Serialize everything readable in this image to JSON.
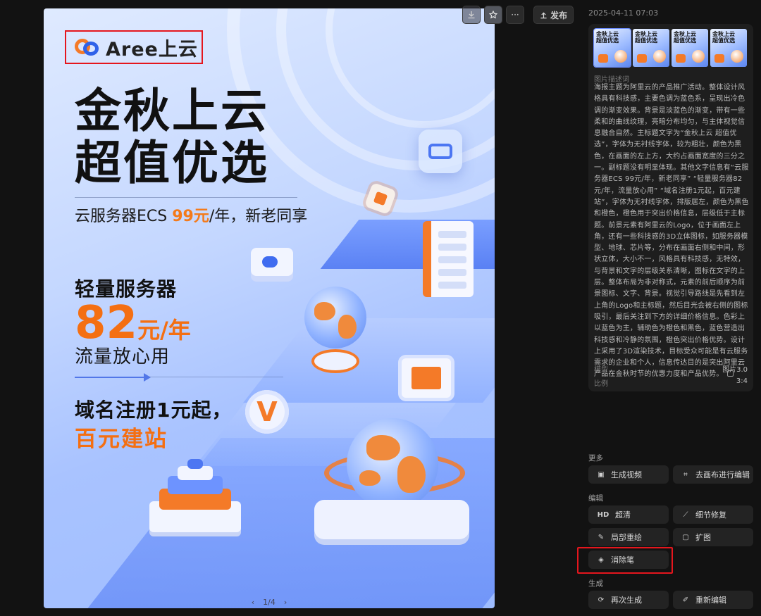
{
  "poster": {
    "logo_text": "Aree上云",
    "title_line1": "金秋上云",
    "title_line2": "超值优选",
    "sub_prefix": "云服务器ECS ",
    "sub_price": "99元",
    "sub_suffix": "/年，新老同享",
    "light_title": "轻量服务器",
    "price_big": "82",
    "price_unit": "元/年",
    "flow_text": "流量放心用",
    "domain_line1": "域名注册1元起，",
    "domain_line2": "百元建站",
    "badge_letter": "V",
    "pager": {
      "prev": "‹",
      "label": "1/4",
      "next": "›"
    }
  },
  "toolbar": {
    "download_icon": "download-icon",
    "star_icon": "star-icon",
    "more_label": "···",
    "publish_label": "发布",
    "publish_icon": "upload-icon"
  },
  "panel": {
    "timestamp": "2025-04-11 07:03",
    "thumbnails": [
      {
        "line1": "金秋上云",
        "line2": "超值优选"
      },
      {
        "line1": "金秋上云",
        "line2": "超值优选"
      },
      {
        "line1": "金秋上云",
        "line2": "超值优选"
      },
      {
        "line1": "金秋上云",
        "line2": "超值优选"
      }
    ],
    "description_label": "图片描述词",
    "description": "海报主题为阿里云的产品推广活动。整体设计风格具有科技感，主要色调为蓝色系，呈现出冷色调的渐变效果。背景是淡蓝色的渐变，带有一些柔和的曲线纹理，亮暗分布均匀，与主体视觉信息融合自然。主标题文字为“金秋上云 超值优选”，字体为无衬线字体，较为粗壮，颜色为黑色，在画面的左上方，大约占画面宽度的三分之一。副标题没有明显体现。其他文字信息有“云服务器ECS 99元/年，新老同享” “轻量服务器82元/年，流量放心用” “域名注册1元起，百元建站”，字体为无衬线字体，排版居左，颜色为黑色和橙色，橙色用于突出价格信息，层级低于主标题。前景元素有阿里云的Logo，位于画面左上角，还有一些科技感的3D立体图标，如服务器模型、地球、芯片等，分布在画面右侧和中间，形状立体，大小不一，风格具有科技感，无特效，与背景和文字的层级关系清晰，图标在文字的上层。整体布局为非对称式，元素的前后顺序为前景图标、文字、背景。视觉引导路线是先看到左上角的Logo和主标题，然后目光会被右侧的图标吸引，最后关注到下方的详细价格信息。色彩上以蓝色为主，辅助色为橙色和黑色，蓝色营造出科技感和冷静的氛围，橙色突出价格优势。设计上采用了3D渲染技术，目标受众可能是有云服务需求的企业和个人，信息传达目的是突出阿里云产品在金秋时节的优惠力度和产品优势。",
    "model_key": "模型",
    "model_value": "图片3.0",
    "ratio_key": "比例",
    "ratio_value": "3:4"
  },
  "sections": {
    "more": "更多",
    "edit": "编辑",
    "generate": "生成"
  },
  "actions": {
    "gen_video": {
      "label": "生成视频",
      "icon": "video-icon"
    },
    "canvas_edit": {
      "label": "去画布进行编辑",
      "icon": "canvas-icon"
    },
    "hd": {
      "label": "超清",
      "icon": "HD"
    },
    "detail_fix": {
      "label": "细节修复",
      "icon": "wand-icon"
    },
    "local_redraw": {
      "label": "局部重绘",
      "icon": "brush-icon"
    },
    "expand": {
      "label": "扩图",
      "icon": "expand-icon"
    },
    "eraser": {
      "label": "消除笔",
      "icon": "eraser-icon"
    },
    "regenerate": {
      "label": "再次生成",
      "icon": "refresh-icon"
    },
    "reedit": {
      "label": "重新编辑",
      "icon": "pencil-icon"
    }
  }
}
